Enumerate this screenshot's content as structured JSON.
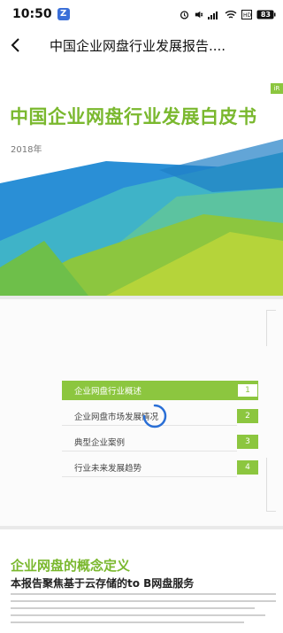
{
  "status_bar": {
    "time": "10:50",
    "app_badge": "Z",
    "battery": "83"
  },
  "nav": {
    "title": "中国企业网盘行业发展报告...."
  },
  "cover": {
    "tab_label": "iR",
    "title": "中国企业网盘行业发展白皮书",
    "year": "2018年"
  },
  "toc": {
    "items": [
      {
        "label": "企业网盘行业概述",
        "num": "1"
      },
      {
        "label": "企业网盘市场发展情况",
        "num": "2"
      },
      {
        "label": "典型企业案例",
        "num": "3"
      },
      {
        "label": "行业未来发展趋势",
        "num": "4"
      }
    ]
  },
  "definition": {
    "title": "企业网盘的概念定义",
    "subtitle": "本报告聚焦基于云存储的to B网盘服务"
  },
  "colors": {
    "brand_green": "#8cc63f",
    "blue": "#2a8fd6"
  }
}
